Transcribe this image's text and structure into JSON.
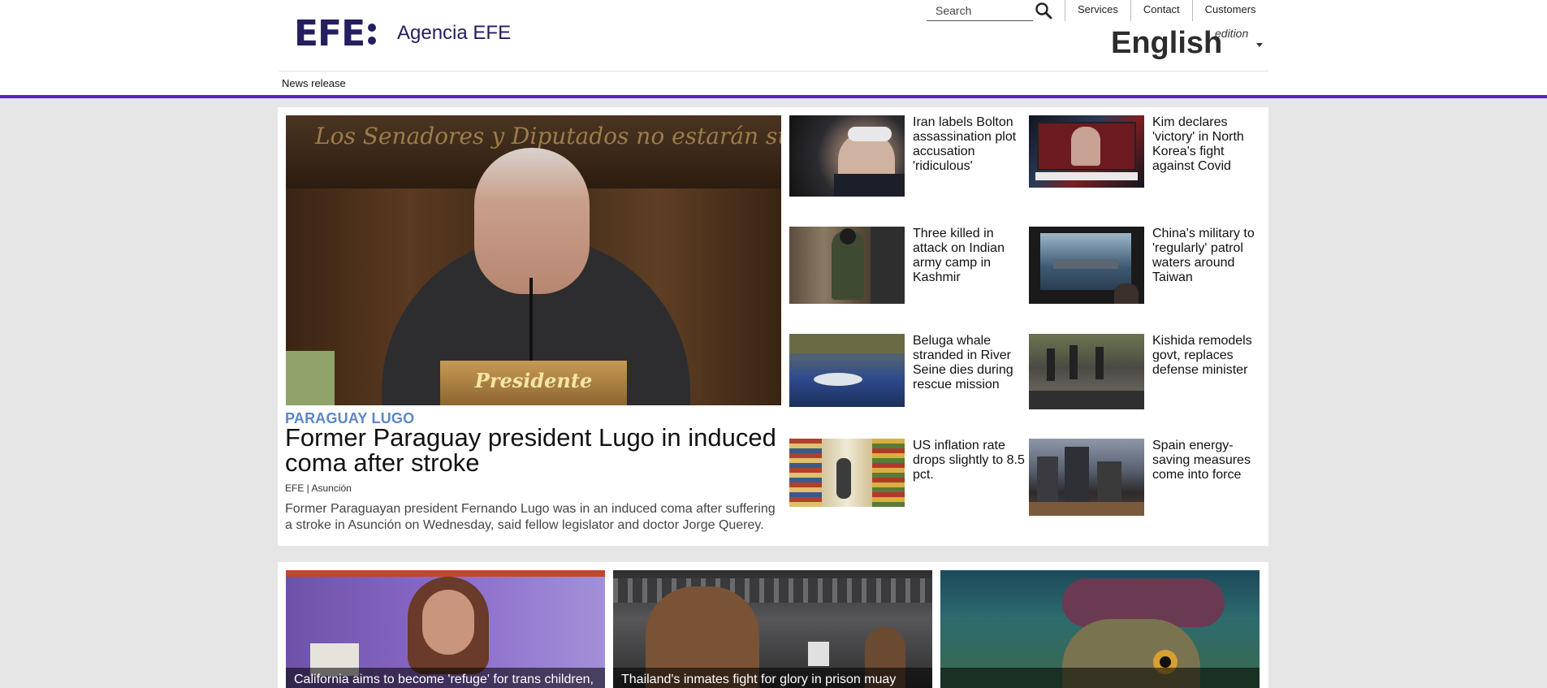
{
  "brand": {
    "logo_text": "EFE",
    "agency_name": "Agencia EFE"
  },
  "search": {
    "placeholder": "Search"
  },
  "topnav": [
    {
      "label": "Services"
    },
    {
      "label": "Contact"
    },
    {
      "label": "Customers"
    }
  ],
  "edition": {
    "language": "English",
    "label": "edition"
  },
  "section_link": "News release",
  "colors": {
    "accent_line": "#5b21c9",
    "brand": "#241f5e",
    "kicker": "#5b87c7"
  },
  "lead": {
    "kicker": "PARAGUAY LUGO",
    "title": "Former Paraguay president Lugo in induced coma after stroke",
    "byline": "EFE | Asunción",
    "summary": "Former Paraguayan president Fernando Lugo was in an induced coma after suffering a stroke in Asunción on Wednesday, said fellow legislator and doctor Jorge Querey.",
    "image_banner_text": "Los Senadores y Diputados no estarán sujetos a mandatos imperativos\"",
    "image_plate_text": "Presidente"
  },
  "stories": [
    {
      "title": "Iran labels Bolton assassination plot accusation 'ridiculous'"
    },
    {
      "title": "Kim declares 'victory' in North Korea's fight against Covid"
    },
    {
      "title": "Three killed in attack on Indian army camp in Kashmir"
    },
    {
      "title": "China's military to 'regularly' patrol waters around Taiwan"
    },
    {
      "title": "Beluga whale stranded in River Seine dies during rescue mission"
    },
    {
      "title": "Kishida remodels govt, replaces defense minister"
    },
    {
      "title": "US inflation rate drops slightly to 8.5 pct."
    },
    {
      "title": "Spain energy-saving measures come into force"
    }
  ],
  "cards": [
    {
      "caption": "California aims to become 'refuge' for trans children,"
    },
    {
      "caption": "Thailand's inmates fight for glory in prison muay"
    },
    {
      "caption": ""
    }
  ]
}
